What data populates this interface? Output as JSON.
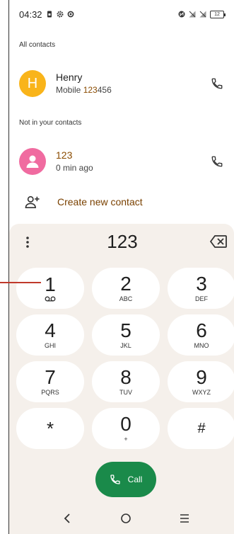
{
  "status_bar": {
    "time": "04:32",
    "battery_level": "12"
  },
  "contacts_section": {
    "label": "All contacts",
    "items": [
      {
        "initial": "H",
        "name": "Henry",
        "detail_prefix": "Mobile ",
        "detail_match": "123",
        "detail_suffix": "456",
        "avatar_color": "#f9b41a"
      }
    ]
  },
  "non_contacts_section": {
    "label": "Not in your contacts",
    "items": [
      {
        "number": "123",
        "detail": "0 min ago",
        "avatar_color": "#f06ba0"
      }
    ]
  },
  "create_contact": {
    "label": "Create new contact"
  },
  "dialpad": {
    "dialed_number": "123",
    "keys": [
      {
        "digit": "1",
        "letters": ""
      },
      {
        "digit": "2",
        "letters": "ABC"
      },
      {
        "digit": "3",
        "letters": "DEF"
      },
      {
        "digit": "4",
        "letters": "GHI"
      },
      {
        "digit": "5",
        "letters": "JKL"
      },
      {
        "digit": "6",
        "letters": "MNO"
      },
      {
        "digit": "7",
        "letters": "PQRS"
      },
      {
        "digit": "8",
        "letters": "TUV"
      },
      {
        "digit": "9",
        "letters": "WXYZ"
      },
      {
        "digit": "*",
        "letters": ""
      },
      {
        "digit": "0",
        "letters": "+"
      },
      {
        "digit": "#",
        "letters": ""
      }
    ],
    "call_label": "Call"
  },
  "colors": {
    "accent": "#8a4b00",
    "call_button": "#1a8a4a",
    "dialpad_bg": "#f5f0eb"
  },
  "icons": {
    "status_left": [
      "sim-card-icon",
      "gear-icon",
      "settings-icon"
    ],
    "status_right": [
      "nfc-icon",
      "no-signal-icon",
      "no-signal-icon",
      "battery-icon"
    ],
    "voicemail": "voicemail-icon"
  }
}
